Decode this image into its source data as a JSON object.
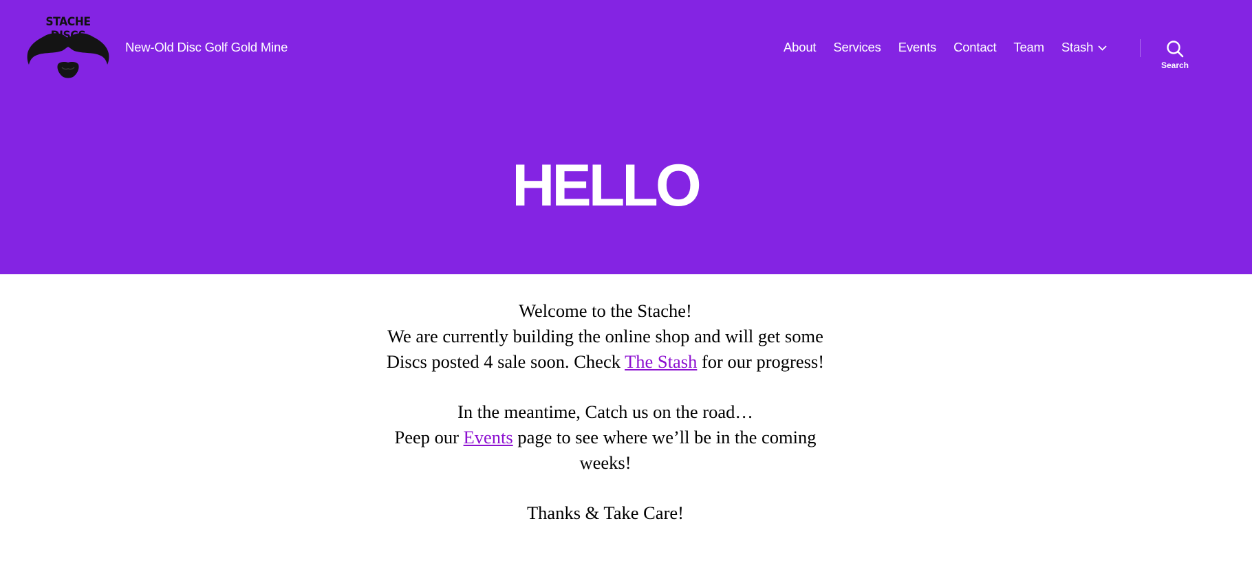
{
  "brand": {
    "logo_text": "STACHE DISCS",
    "tagline": "New-Old Disc Golf Gold Mine",
    "accent_color": "#8424e3"
  },
  "nav": {
    "items": [
      {
        "label": "About"
      },
      {
        "label": "Services"
      },
      {
        "label": "Events"
      },
      {
        "label": "Contact"
      },
      {
        "label": "Team"
      },
      {
        "label": "Stash",
        "has_dropdown": true
      }
    ]
  },
  "search": {
    "label": "Search",
    "icon": "search-icon"
  },
  "hero": {
    "title": "HELLO"
  },
  "content": {
    "p1_line1": "Welcome to the Stache!",
    "p1_text_before": "We are currently building the online shop and will get some Discs posted 4 sale soon. Check ",
    "p1_link": "The Stash",
    "p1_text_after": " for our progress!",
    "p2_line1": "In the meantime, Catch us on the road…",
    "p2_text_before": "Peep our ",
    "p2_link": "Events",
    "p2_text_after": " page to see where we’ll be in the coming weeks!",
    "p3": "Thanks & Take Care!",
    "link_color": "#8c0fd0"
  }
}
